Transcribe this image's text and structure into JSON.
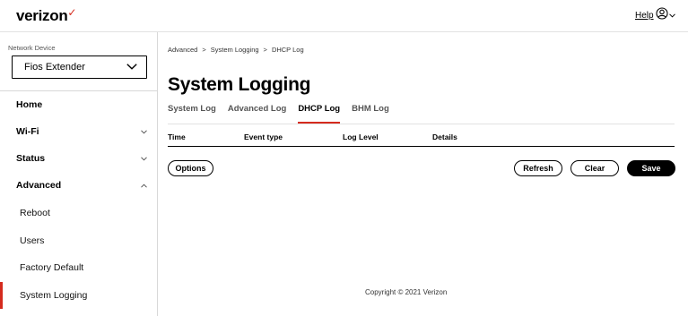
{
  "header": {
    "logo_text": "verizon",
    "logo_mark": "✓",
    "help_label": "Help",
    "account_icon": "user-circle-icon"
  },
  "sidebar": {
    "device_label": "Network Device",
    "device_value": "Fios Extender",
    "items": [
      {
        "label": "Home",
        "expandable": false
      },
      {
        "label": "Wi-Fi",
        "expandable": true,
        "expanded": false
      },
      {
        "label": "Status",
        "expandable": true,
        "expanded": false
      },
      {
        "label": "Advanced",
        "expandable": true,
        "expanded": true
      }
    ],
    "sub_items": [
      {
        "label": "Reboot",
        "active": false
      },
      {
        "label": "Users",
        "active": false
      },
      {
        "label": "Factory Default",
        "active": false
      },
      {
        "label": "System Logging",
        "active": true
      }
    ]
  },
  "main": {
    "breadcrumb": [
      "Advanced",
      "System Logging",
      "DHCP Log"
    ],
    "breadcrumb_sep": ">",
    "title": "System Logging",
    "tabs": [
      {
        "label": "System Log",
        "active": false
      },
      {
        "label": "Advanced Log",
        "active": false
      },
      {
        "label": "DHCP Log",
        "active": true
      },
      {
        "label": "BHM Log",
        "active": false
      }
    ],
    "table": {
      "columns": [
        "Time",
        "Event type",
        "Log Level",
        "Details"
      ],
      "rows": []
    },
    "buttons": {
      "options": "Options",
      "refresh": "Refresh",
      "clear": "Clear",
      "save": "Save"
    }
  },
  "footer": {
    "copyright": "Copyright © 2021 Verizon"
  },
  "colors": {
    "accent": "#d52b1e",
    "text": "#000000",
    "border": "#d8d8d8"
  }
}
